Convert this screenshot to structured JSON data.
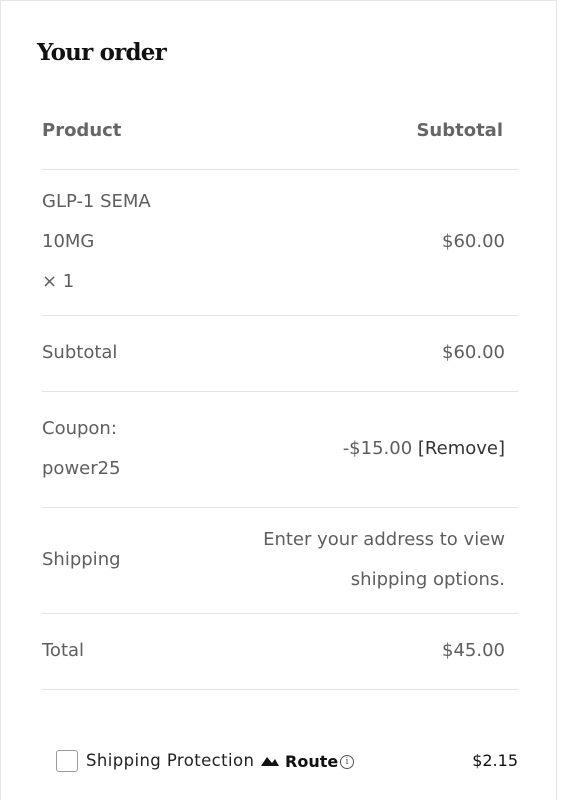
{
  "order": {
    "title": "Your order",
    "header": {
      "product": "Product",
      "subtotal": "Subtotal"
    },
    "item": {
      "name_line1": "GLP-1 SEMA",
      "name_line2": "10MG",
      "qty": "× 1",
      "price": "$60.00"
    },
    "subtotal": {
      "label": "Subtotal",
      "value": "$60.00"
    },
    "coupon": {
      "label_line1": "Coupon:",
      "label_line2": "power25",
      "value": "-$15.00",
      "remove_label": "[Remove]"
    },
    "shipping": {
      "label": "Shipping",
      "note_line1": "Enter your address to view",
      "note_line2": "shipping options."
    },
    "total": {
      "label": "Total",
      "value": "$45.00"
    },
    "protection": {
      "label": "Shipping Protection",
      "brand": "Route",
      "price": "$2.15",
      "checked": false
    }
  }
}
